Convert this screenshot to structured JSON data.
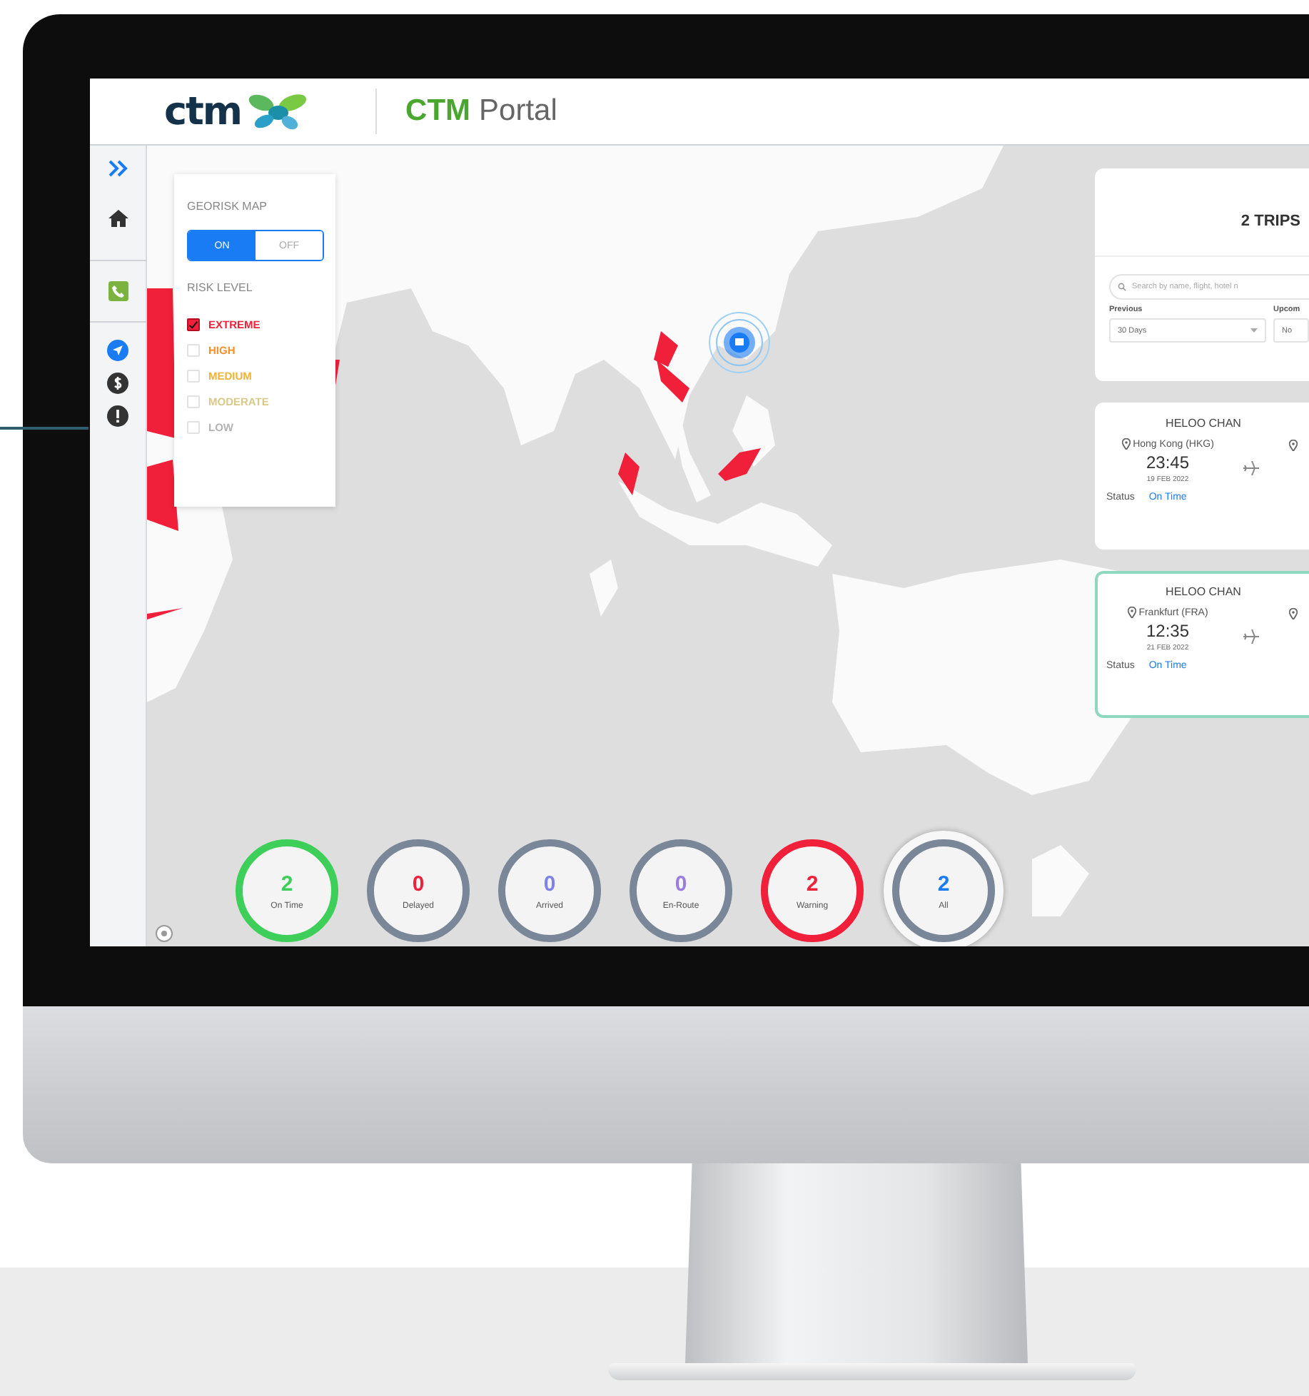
{
  "header": {
    "logo_text": "ctm",
    "brand": "CTM",
    "title": "Portal"
  },
  "georisk": {
    "title": "GEORISK MAP",
    "toggle": [
      {
        "label": "ON",
        "selected": true
      },
      {
        "label": "OFF",
        "selected": false
      }
    ],
    "risk_title": "RISK LEVEL",
    "levels": [
      {
        "label": "EXTREME",
        "checked": true,
        "color": "#f0203a"
      },
      {
        "label": "HIGH",
        "checked": false,
        "color": "#f5902a"
      },
      {
        "label": "MEDIUM",
        "checked": false,
        "color": "#f2b23a"
      },
      {
        "label": "MODERATE",
        "checked": false,
        "color": "#d8c98a"
      },
      {
        "label": "LOW",
        "checked": false,
        "color": "#b3b3b3"
      }
    ]
  },
  "trips": {
    "count": "2 TRIPS",
    "search": {
      "placeholder": "Search by name, flight, hotel n"
    },
    "filters": [
      {
        "label": "Previous",
        "value": "30 Days"
      },
      {
        "label": "Upcom",
        "value": "No"
      }
    ],
    "cards": [
      {
        "name": "HELOO CHAN",
        "origin": "Hong Kong (HKG)",
        "time": "23:45",
        "date": "19 FEB 2022",
        "status_label": "Status",
        "status": "On Time",
        "selected": false
      },
      {
        "name": "HELOO CHAN",
        "origin": "Frankfurt (FRA)",
        "time": "12:35",
        "date": "21 FEB 2022",
        "status_label": "Status",
        "status": "On Time",
        "selected": true
      }
    ]
  },
  "summary": [
    {
      "kind": "highlight",
      "count": "2",
      "label": "On Time",
      "color": "#3ecf5a",
      "selected": false
    },
    {
      "kind": "plain",
      "count": "0",
      "label": "Delayed",
      "color": "#f0203a",
      "selected": false
    },
    {
      "kind": "plain",
      "count": "0",
      "label": "Arrived",
      "color": "#7b83eb",
      "selected": false
    },
    {
      "kind": "plain",
      "count": "0",
      "label": "En-Route",
      "color": "#9a7be0",
      "selected": false
    },
    {
      "kind": "highlight",
      "count": "2",
      "label": "Warning",
      "color": "#f0203a",
      "selected": false
    },
    {
      "kind": "plain",
      "count": "2",
      "label": "All",
      "color": "#1a7cf5",
      "selected": true
    }
  ]
}
